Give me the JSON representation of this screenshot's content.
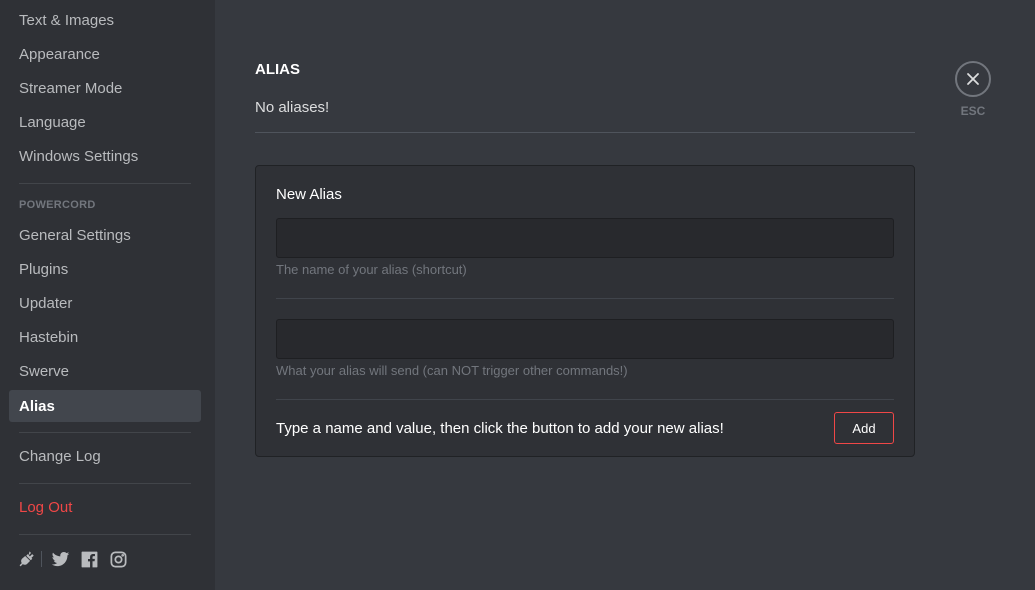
{
  "sidebar": {
    "items_top": [
      {
        "label": "Text & Images"
      },
      {
        "label": "Appearance"
      },
      {
        "label": "Streamer Mode"
      },
      {
        "label": "Language"
      },
      {
        "label": "Windows Settings"
      }
    ],
    "section_header": "POWERCORD",
    "items_powercord": [
      {
        "label": "General Settings"
      },
      {
        "label": "Plugins"
      },
      {
        "label": "Updater"
      },
      {
        "label": "Hastebin"
      },
      {
        "label": "Swerve"
      },
      {
        "label": "Alias",
        "selected": true
      }
    ],
    "change_log": "Change Log",
    "log_out": "Log Out",
    "social_icons": [
      "plug-icon",
      "twitter-icon",
      "facebook-icon",
      "instagram-icon"
    ]
  },
  "main": {
    "title": "ALIAS",
    "empty_message": "No aliases!",
    "new_alias": {
      "title": "New Alias",
      "name_field": {
        "value": "",
        "hint": "The name of your alias (shortcut)"
      },
      "command_field": {
        "value": "",
        "hint": "What your alias will send (can NOT trigger other commands!)"
      },
      "instructions": "Type a name and value, then click the button to add your new alias!",
      "add_label": "Add"
    }
  },
  "close": {
    "icon": "close-icon",
    "label": "ESC"
  },
  "colors": {
    "background": "#36393f",
    "sidebar": "#2f3136",
    "selected": "#42464d",
    "danger": "#f04747"
  }
}
